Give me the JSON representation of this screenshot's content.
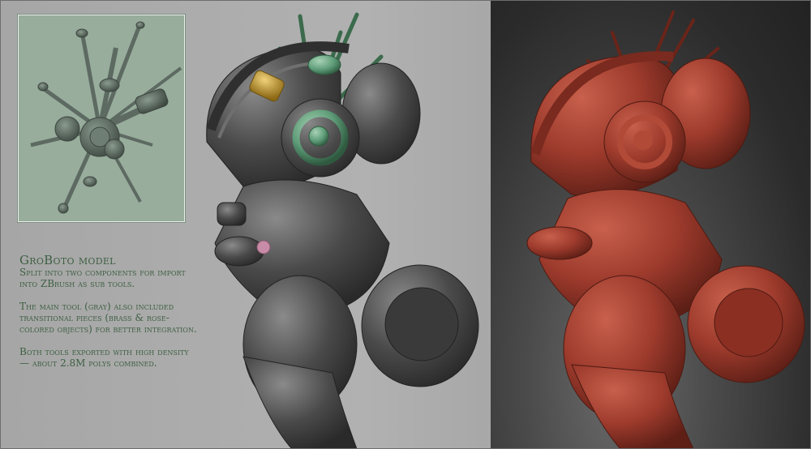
{
  "caption": {
    "title": "GroBoto model",
    "paragraphs": [
      "Split into two components for import into ZBrush as sub tools.",
      "The main tool (gray) also included transitional pieces (brass & rose-colored objects) for better integration.",
      "Both tools exported with high density — about 2.8M polys combined."
    ]
  },
  "colors": {
    "caption_text": "#3e5f42",
    "inset_bg": "#98ad9c",
    "gray_model": "#4a4a4a",
    "green_parts": "#5e9c78",
    "brass_parts": "#c89a2e",
    "rose_parts": "#c98ca8",
    "clay_model": "#9c3a2c",
    "dark_bg": "#2b2b2b"
  }
}
